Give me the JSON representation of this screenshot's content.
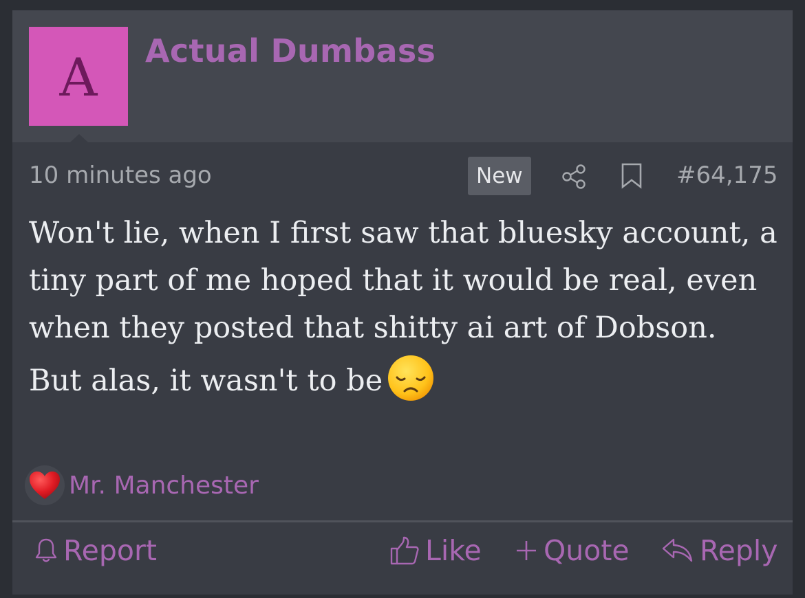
{
  "post": {
    "avatar_letter": "A",
    "username": "Actual Dumbass",
    "time": "10 minutes ago",
    "badge": "New",
    "number": "#64,175",
    "paragraphs": [
      "Won't lie, when I first saw that bluesky account, a tiny part of me hoped that it would be real, even when they posted that shitty ai art of Dobson.",
      "But alas, it wasn't to be"
    ],
    "emoji": "disappointed-face-icon",
    "reaction": {
      "icon": "heart-icon",
      "user": "Mr. Manchester"
    },
    "actions": {
      "report": "Report",
      "like": "Like",
      "quote": "Quote",
      "reply": "Reply"
    }
  },
  "colors": {
    "accent": "#a867b2",
    "avatar_bg": "#d457b8",
    "background": "#393c44",
    "header_bg": "#44474f"
  }
}
